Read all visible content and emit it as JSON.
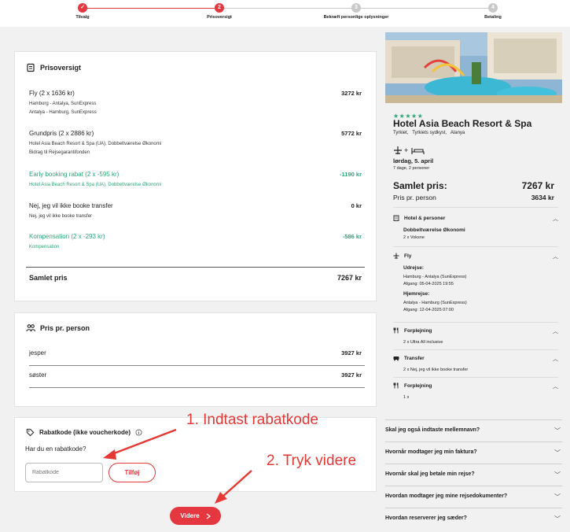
{
  "stepper": {
    "steps": [
      {
        "label": "Tilvalg",
        "number": "✓",
        "state": "done"
      },
      {
        "label": "Prisoversigt",
        "number": "2",
        "state": "active"
      },
      {
        "label": "Bekræft personlige oplysninger",
        "number": "3",
        "state": "todo"
      },
      {
        "label": "Betaling",
        "number": "4",
        "state": "todo"
      }
    ]
  },
  "price_overview": {
    "title": "Prisoversigt",
    "items": [
      {
        "title": "Fly (2 x 1636 kr)",
        "sub": [
          "Hamburg - Antalya, SunExpress",
          "Antalya - Hamburg, SunExpress"
        ],
        "amount": "3272 kr",
        "green": false
      },
      {
        "title": "Grundpris (2 x 2886 kr)",
        "sub": [
          "Hotel Asia Beach Resort & Spa (UA), Dobbeltværelse Økonomi",
          "Bidrag til Rejsegarantifonden"
        ],
        "amount": "5772 kr",
        "green": false
      },
      {
        "title": "Early booking rabat (2 x -595 kr)",
        "sub": [
          "Hotel Asia Beach Resort & Spa (UA), Dobbeltværelse Økonomi"
        ],
        "amount": "-1190 kr",
        "green": true
      },
      {
        "title": "Nej, jeg vil ikke booke transfer",
        "sub": [
          "Nej, jeg vil ikke booke transfer"
        ],
        "amount": "0 kr",
        "green": false
      },
      {
        "title": "Kompensation (2 x -293 kr)",
        "sub": [
          "Kompensation"
        ],
        "amount": "-586 kr",
        "green": true
      }
    ],
    "total_label": "Samlet pris",
    "total_amount": "7267 kr"
  },
  "per_person": {
    "title": "Pris pr. person",
    "rows": [
      {
        "name": "jesper",
        "amount": "3927 kr"
      },
      {
        "name": "søster",
        "amount": "3927 kr"
      }
    ]
  },
  "promo": {
    "title": "Rabatkode (ikke voucherkode)",
    "question": "Har du en rabatkode?",
    "placeholder": "Rabatkode",
    "add_label": "Tilføj"
  },
  "next_button": {
    "label": "Videre"
  },
  "annotations": {
    "step1": "1. Indtast rabatkode",
    "step2": "2. Tryk videre"
  },
  "hotel": {
    "stars": "★★★★★",
    "name": "Hotel Asia Beach Resort & Spa",
    "location": "Tyrkiet,   Tyrkiets sydkyst,   Alanya",
    "date": "lørdag, 5. april",
    "duration": "7 dage, 2 personer",
    "total_label": "Samlet pris:",
    "total_amount": "7267 kr",
    "pp_label": "Pris pr. person",
    "pp_amount": "3634 kr"
  },
  "sidebar_sections": {
    "hotel": {
      "title": "Hotel & personer",
      "room": "Dobbeltværelse Økonomi",
      "guests": "2 x Voksne"
    },
    "flight": {
      "title": "Fly",
      "out_label": "Udrejse:",
      "out_route": "Hamburg - Antalya (SunExpress)",
      "out_time": "Afgang: 05-04-2025 19:55",
      "ret_label": "Hjemrejse:",
      "ret_route": "Antalya - Hamburg (SunExpress)",
      "ret_time": "Afgang: 12-04-2025 07:00"
    },
    "meals": {
      "title": "Forplejning",
      "value": "2 x Ultra All inclusive"
    },
    "transfer": {
      "title": "Transfer",
      "value": "2 x Nej, jeg vil ikke booke transfer"
    },
    "meals2": {
      "title": "Forplejning",
      "value": "1 x"
    }
  },
  "faq": [
    "Skal jeg også indtaste mellemnavn?",
    "Hvornår modtager jeg min faktura?",
    "Hvornår skal jeg betale min rejse?",
    "Hvordan modtager jeg mine rejsedokumenter?",
    "Hvordan reserverer jeg sæder?"
  ],
  "colors": {
    "accent": "#e4373f",
    "green": "#2aa777"
  }
}
